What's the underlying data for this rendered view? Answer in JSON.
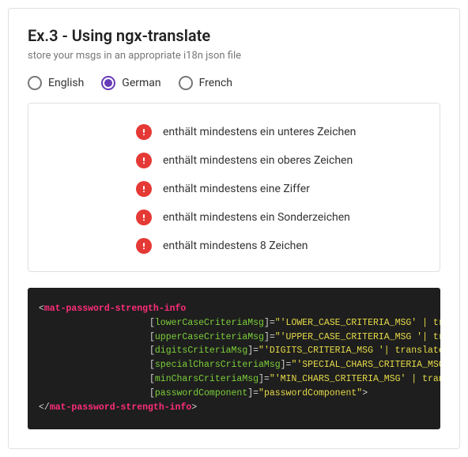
{
  "header": {
    "title": "Ex.3 - Using ngx-translate",
    "subtitle": "store your msgs in an appropriate i18n json file"
  },
  "languages": {
    "options": [
      {
        "label": "English",
        "selected": false
      },
      {
        "label": "German",
        "selected": true
      },
      {
        "label": "French",
        "selected": false
      }
    ]
  },
  "criteria": [
    {
      "text": "enthält mindestens ein unteres Zeichen"
    },
    {
      "text": "enthält mindestens ein oberes Zeichen"
    },
    {
      "text": "enthält mindestens eine Ziffer"
    },
    {
      "text": "enthält mindestens ein Sonderzeichen"
    },
    {
      "text": "enthält mindestens 8 Zeichen"
    }
  ],
  "code": {
    "tag": "mat-password-strength-info",
    "attrs": [
      {
        "name": "lowerCaseCriteriaMsg",
        "value": "'LOWER_CASE_CRITERIA_MSG' | translate"
      },
      {
        "name": "upperCaseCriteriaMsg",
        "value": "'UPPER_CASE_CRITERIA_MSG '| translate"
      },
      {
        "name": "digitsCriteriaMsg",
        "value": "'DIGITS_CRITERIA_MSG '| translate"
      },
      {
        "name": "specialCharsCriteriaMsg",
        "value": "'SPECIAL_CHARS_CRITERIA_MSG' | translate"
      },
      {
        "name": "minCharsCriteriaMsg",
        "value": "'MIN_CHARS_CRITERIA_MSG' | translate"
      },
      {
        "name": "passwordComponent",
        "value": "passwordComponent"
      }
    ]
  }
}
